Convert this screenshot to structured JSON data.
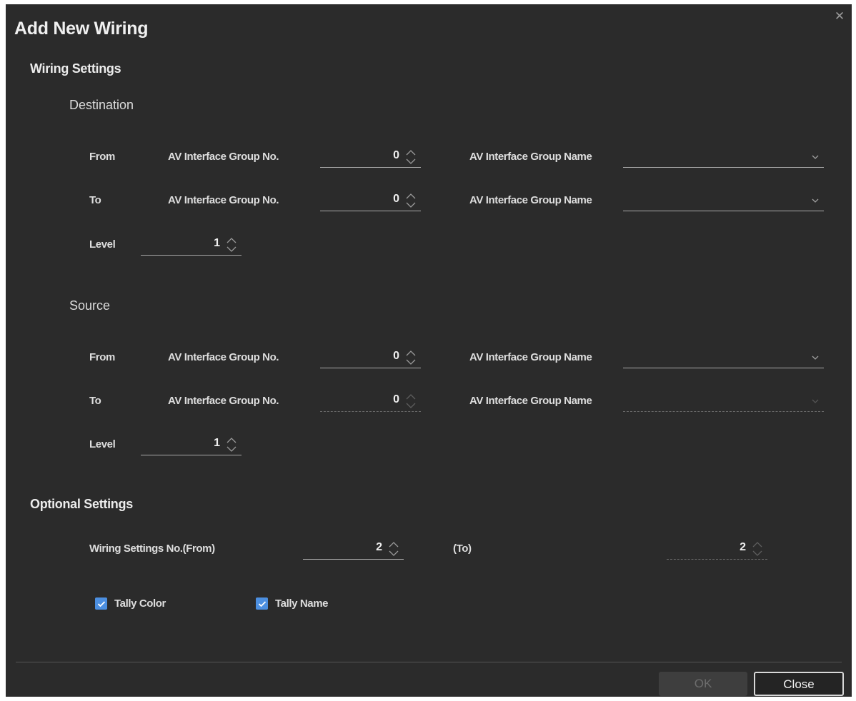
{
  "dialog": {
    "title": "Add New Wiring",
    "close_icon": "close-icon"
  },
  "wiring_settings": {
    "title": "Wiring Settings",
    "destination": {
      "title": "Destination",
      "from": {
        "label": "From",
        "group_no_label": "AV Interface Group No.",
        "group_no_value": "0",
        "group_name_label": "AV Interface Group Name",
        "group_name_value": ""
      },
      "to": {
        "label": "To",
        "group_no_label": "AV Interface Group No.",
        "group_no_value": "0",
        "group_name_label": "AV Interface Group Name",
        "group_name_value": ""
      },
      "level": {
        "label": "Level",
        "value": "1"
      }
    },
    "source": {
      "title": "Source",
      "from": {
        "label": "From",
        "group_no_label": "AV Interface Group No.",
        "group_no_value": "0",
        "group_name_label": "AV Interface Group Name",
        "group_name_value": ""
      },
      "to": {
        "label": "To",
        "group_no_label": "AV Interface Group No.",
        "group_no_value": "0",
        "group_name_label": "AV Interface Group Name",
        "group_name_value": "",
        "disabled": true
      },
      "level": {
        "label": "Level",
        "value": "1"
      }
    }
  },
  "optional_settings": {
    "title": "Optional Settings",
    "wiring_no_from_label": "Wiring Settings No.(From)",
    "wiring_no_from_value": "2",
    "wiring_no_to_label": "(To)",
    "wiring_no_to_value": "2",
    "wiring_no_to_disabled": true,
    "tally_color": {
      "label": "Tally Color",
      "checked": true
    },
    "tally_name": {
      "label": "Tally Name",
      "checked": true
    }
  },
  "footer": {
    "ok_label": "OK",
    "ok_disabled": true,
    "close_label": "Close"
  },
  "colors": {
    "dialog_bg": "#2b2b2b",
    "checkbox_accent": "#4c8fe0",
    "text": "#e6e6e6"
  }
}
